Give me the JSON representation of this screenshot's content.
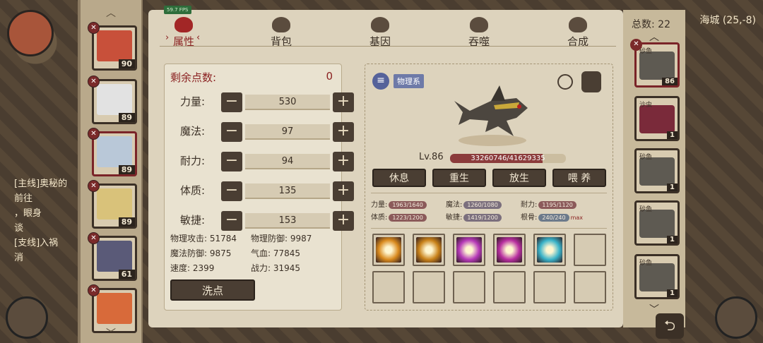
{
  "fps": "59.7 FPS",
  "world": {
    "location": "海城 (25,-8)",
    "quest_lines": [
      "[主线]奥秘的",
      "前往",
      "，眼身",
      "谈",
      "[支线]入祸",
      "消"
    ]
  },
  "tabs": [
    {
      "label": "属性",
      "icon": "flame-icon",
      "active": true
    },
    {
      "label": "背包",
      "icon": "pouch-icon",
      "active": false
    },
    {
      "label": "基因",
      "icon": "eye-icon",
      "active": false
    },
    {
      "label": "吞噬",
      "icon": "spiral-icon",
      "active": false
    },
    {
      "label": "合成",
      "icon": "shell-icon",
      "active": false
    }
  ],
  "roster": [
    {
      "level": "90",
      "color": "#c8503a",
      "selected": false
    },
    {
      "level": "89",
      "color": "#e2e2e2",
      "selected": false
    },
    {
      "level": "89",
      "color": "#b9c8d8",
      "selected": true
    },
    {
      "level": "89",
      "color": "#d9c27a",
      "selected": false
    },
    {
      "level": "61",
      "color": "#5a5a78",
      "selected": false
    },
    {
      "level": "",
      "color": "#d86a3a",
      "selected": false
    }
  ],
  "attributes": {
    "remaining_label": "剩余点数:",
    "remaining_value": "0",
    "rows": [
      {
        "name": "力量:",
        "value": "530"
      },
      {
        "name": "魔法:",
        "value": "97"
      },
      {
        "name": "耐力:",
        "value": "94"
      },
      {
        "name": "体质:",
        "value": "135"
      },
      {
        "name": "敏捷:",
        "value": "153"
      }
    ],
    "stats": [
      "物理攻击: 51784",
      "物理防御: 9987",
      "魔法防御: 9875",
      "气血: 77845",
      "速度: 2399",
      "战力: 31945"
    ],
    "reset_label": "洗点"
  },
  "creature": {
    "type_label": "物理系",
    "level_text": "Lv.86",
    "hp_text": "33260746/41629335",
    "hp_fraction": 0.799,
    "actions": [
      "休息",
      "重生",
      "放生",
      "喂 养"
    ],
    "minis": [
      {
        "label": "力量:",
        "value": "1963/1640",
        "style": "r"
      },
      {
        "label": "魔法:",
        "value": "1260/1080",
        "style": ""
      },
      {
        "label": "耐力:",
        "value": "1195/1120",
        "style": "r"
      },
      {
        "label": "体质:",
        "value": "1223/1200",
        "style": "r"
      },
      {
        "label": "敏捷:",
        "value": "1419/1200",
        "style": ""
      },
      {
        "label": "根骨:",
        "value": "240/240",
        "style": "b"
      }
    ],
    "max_label": "max",
    "skills": [
      "#d98a1e",
      "#c9821a",
      "#b63ab8",
      "#b82fa0",
      "#3ab3c9",
      "",
      "",
      "",
      "",
      "",
      "",
      ""
    ]
  },
  "right_list": {
    "total": "总数: 22",
    "items": [
      {
        "name": "砂鱼",
        "count": "86",
        "selected": true,
        "color": "#5e5a52"
      },
      {
        "name": "沙虫",
        "count": "1",
        "selected": false,
        "color": "#7a2a3a"
      },
      {
        "name": "砂鱼",
        "count": "1",
        "selected": false,
        "color": "#5e5a52"
      },
      {
        "name": "砂鱼",
        "count": "1",
        "selected": false,
        "color": "#5e5a52"
      },
      {
        "name": "砂鱼",
        "count": "1",
        "selected": false,
        "color": "#5e5a52"
      }
    ]
  }
}
